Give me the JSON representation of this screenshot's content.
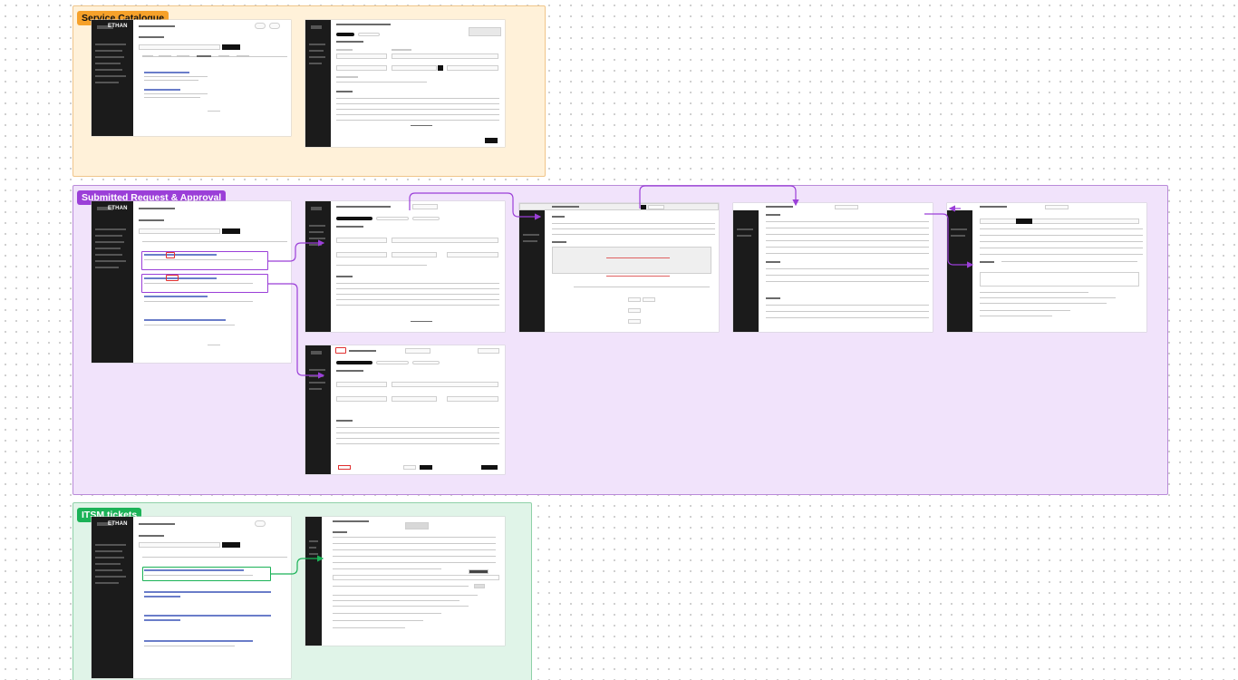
{
  "sections": {
    "service_catalogue": {
      "label": "Service Catalogue",
      "bg": "#fff1d9",
      "border": "#f0c58a",
      "tag_bg": "#f6a12a",
      "tag_color": "#111111"
    },
    "submitted_request": {
      "label": "Submitted Request & Approval",
      "bg": "#f1e3fb",
      "border": "#b98bd9",
      "tag_bg": "#9b3fd8",
      "tag_color": "#ffffff"
    },
    "itsm_tickets": {
      "label": "ITSM tickets",
      "bg": "#e0f4e8",
      "border": "#8fd1a8",
      "tag_bg": "#1bb257",
      "tag_color": "#ffffff"
    }
  },
  "frames": {
    "brand": "ETHAN"
  },
  "colors": {
    "purple_arrow": "#9b3fd8",
    "green_arrow": "#1bb257",
    "red_highlight": "#e03030"
  }
}
